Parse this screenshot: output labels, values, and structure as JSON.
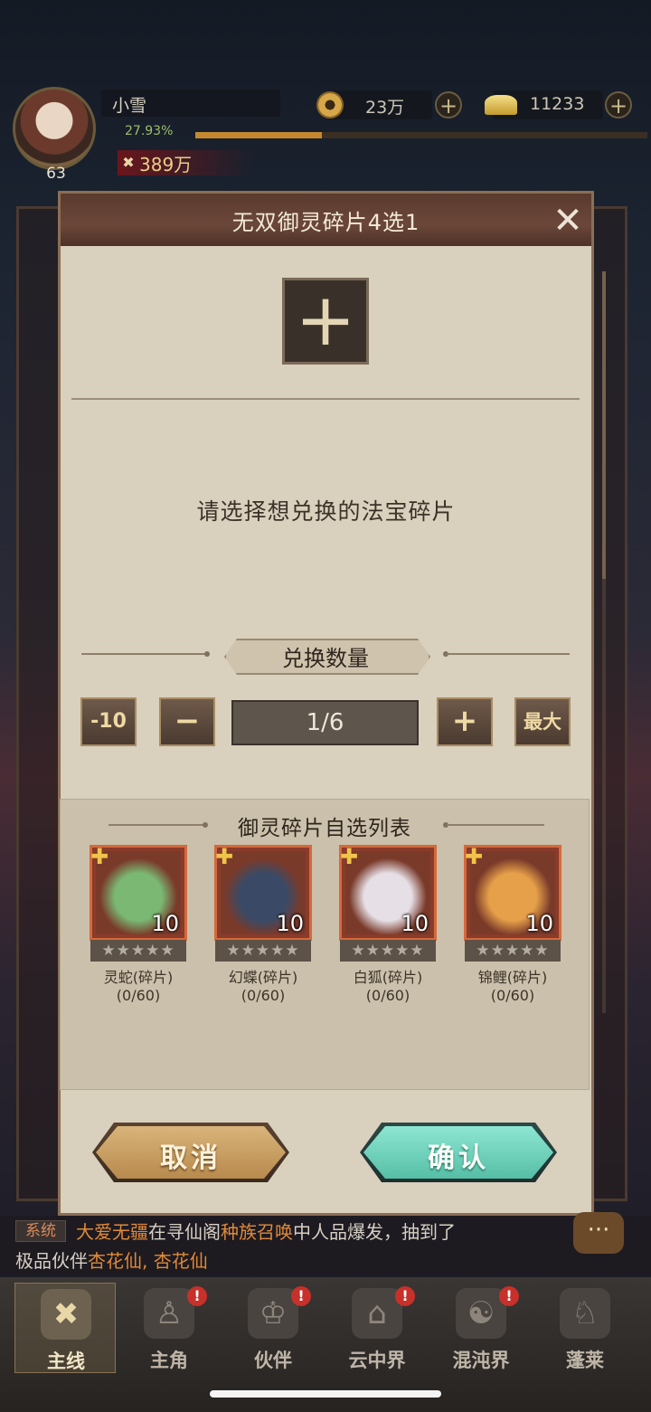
{
  "player": {
    "name": "小雪",
    "level": "63",
    "exp_percent": "27.93%",
    "exp_fill": 0.2793,
    "power": "389万",
    "power_icon": "crossed-swords-icon"
  },
  "currency": {
    "coins": "23万",
    "coins_icon": "coin-icon",
    "ingots": "11233",
    "ingots_icon": "gold-ingot-icon",
    "add_symbol": "+"
  },
  "dialog": {
    "title": "无双御灵碎片4选1",
    "close_symbol": "✕",
    "slot_symbol": "+",
    "prompt": "请选择想兑换的法宝碎片",
    "quantity_label": "兑换数量",
    "minus10_label": "-10",
    "minus_label": "−",
    "quantity_value": "1/6",
    "plus_label": "+",
    "max_label": "最大",
    "list_title": "御灵碎片自选列表",
    "cancel_label": "取消",
    "confirm_label": "确认"
  },
  "fragments": [
    {
      "name": "灵蛇(碎片)",
      "progress": "(0/60)",
      "count": "10",
      "stars": "★★★★★",
      "color": "#7ab874"
    },
    {
      "name": "幻蝶(碎片)",
      "progress": "(0/60)",
      "count": "10",
      "stars": "★★★★★",
      "color": "#3a4a66"
    },
    {
      "name": "白狐(碎片)",
      "progress": "(0/60)",
      "count": "10",
      "stars": "★★★★★",
      "color": "#e6dfe6"
    },
    {
      "name": "锦鲤(碎片)",
      "progress": "(0/60)",
      "count": "10",
      "stars": "★★★★★",
      "color": "#e6a04a"
    }
  ],
  "chat": {
    "tag": "系统",
    "player": "大爱无疆",
    "text1": "在寻仙阁",
    "event": "种族召唤",
    "text2": "中人品爆发，抽到了",
    "text3": "极品伙伴",
    "reward": "杏花仙, 杏花仙"
  },
  "nav": [
    {
      "label": "主线",
      "icon": "swords-icon",
      "active": true,
      "badge": ""
    },
    {
      "label": "主角",
      "icon": "hero-icon",
      "active": false,
      "badge": "!"
    },
    {
      "label": "伙伴",
      "icon": "partner-icon",
      "active": false,
      "badge": "!"
    },
    {
      "label": "云中界",
      "icon": "pavilion-icon",
      "active": false,
      "badge": "!"
    },
    {
      "label": "混沌界",
      "icon": "chaos-icon",
      "active": false,
      "badge": "!"
    },
    {
      "label": "蓬莱",
      "icon": "sage-icon",
      "active": false,
      "badge": ""
    }
  ],
  "colors": {
    "accent_gold": "#efd9a4",
    "dialog_bg": "#d9d0bd",
    "cancel_button": "#c9a067",
    "confirm_button": "#6fd3bd",
    "chat_highlight": "#e08a3a"
  }
}
